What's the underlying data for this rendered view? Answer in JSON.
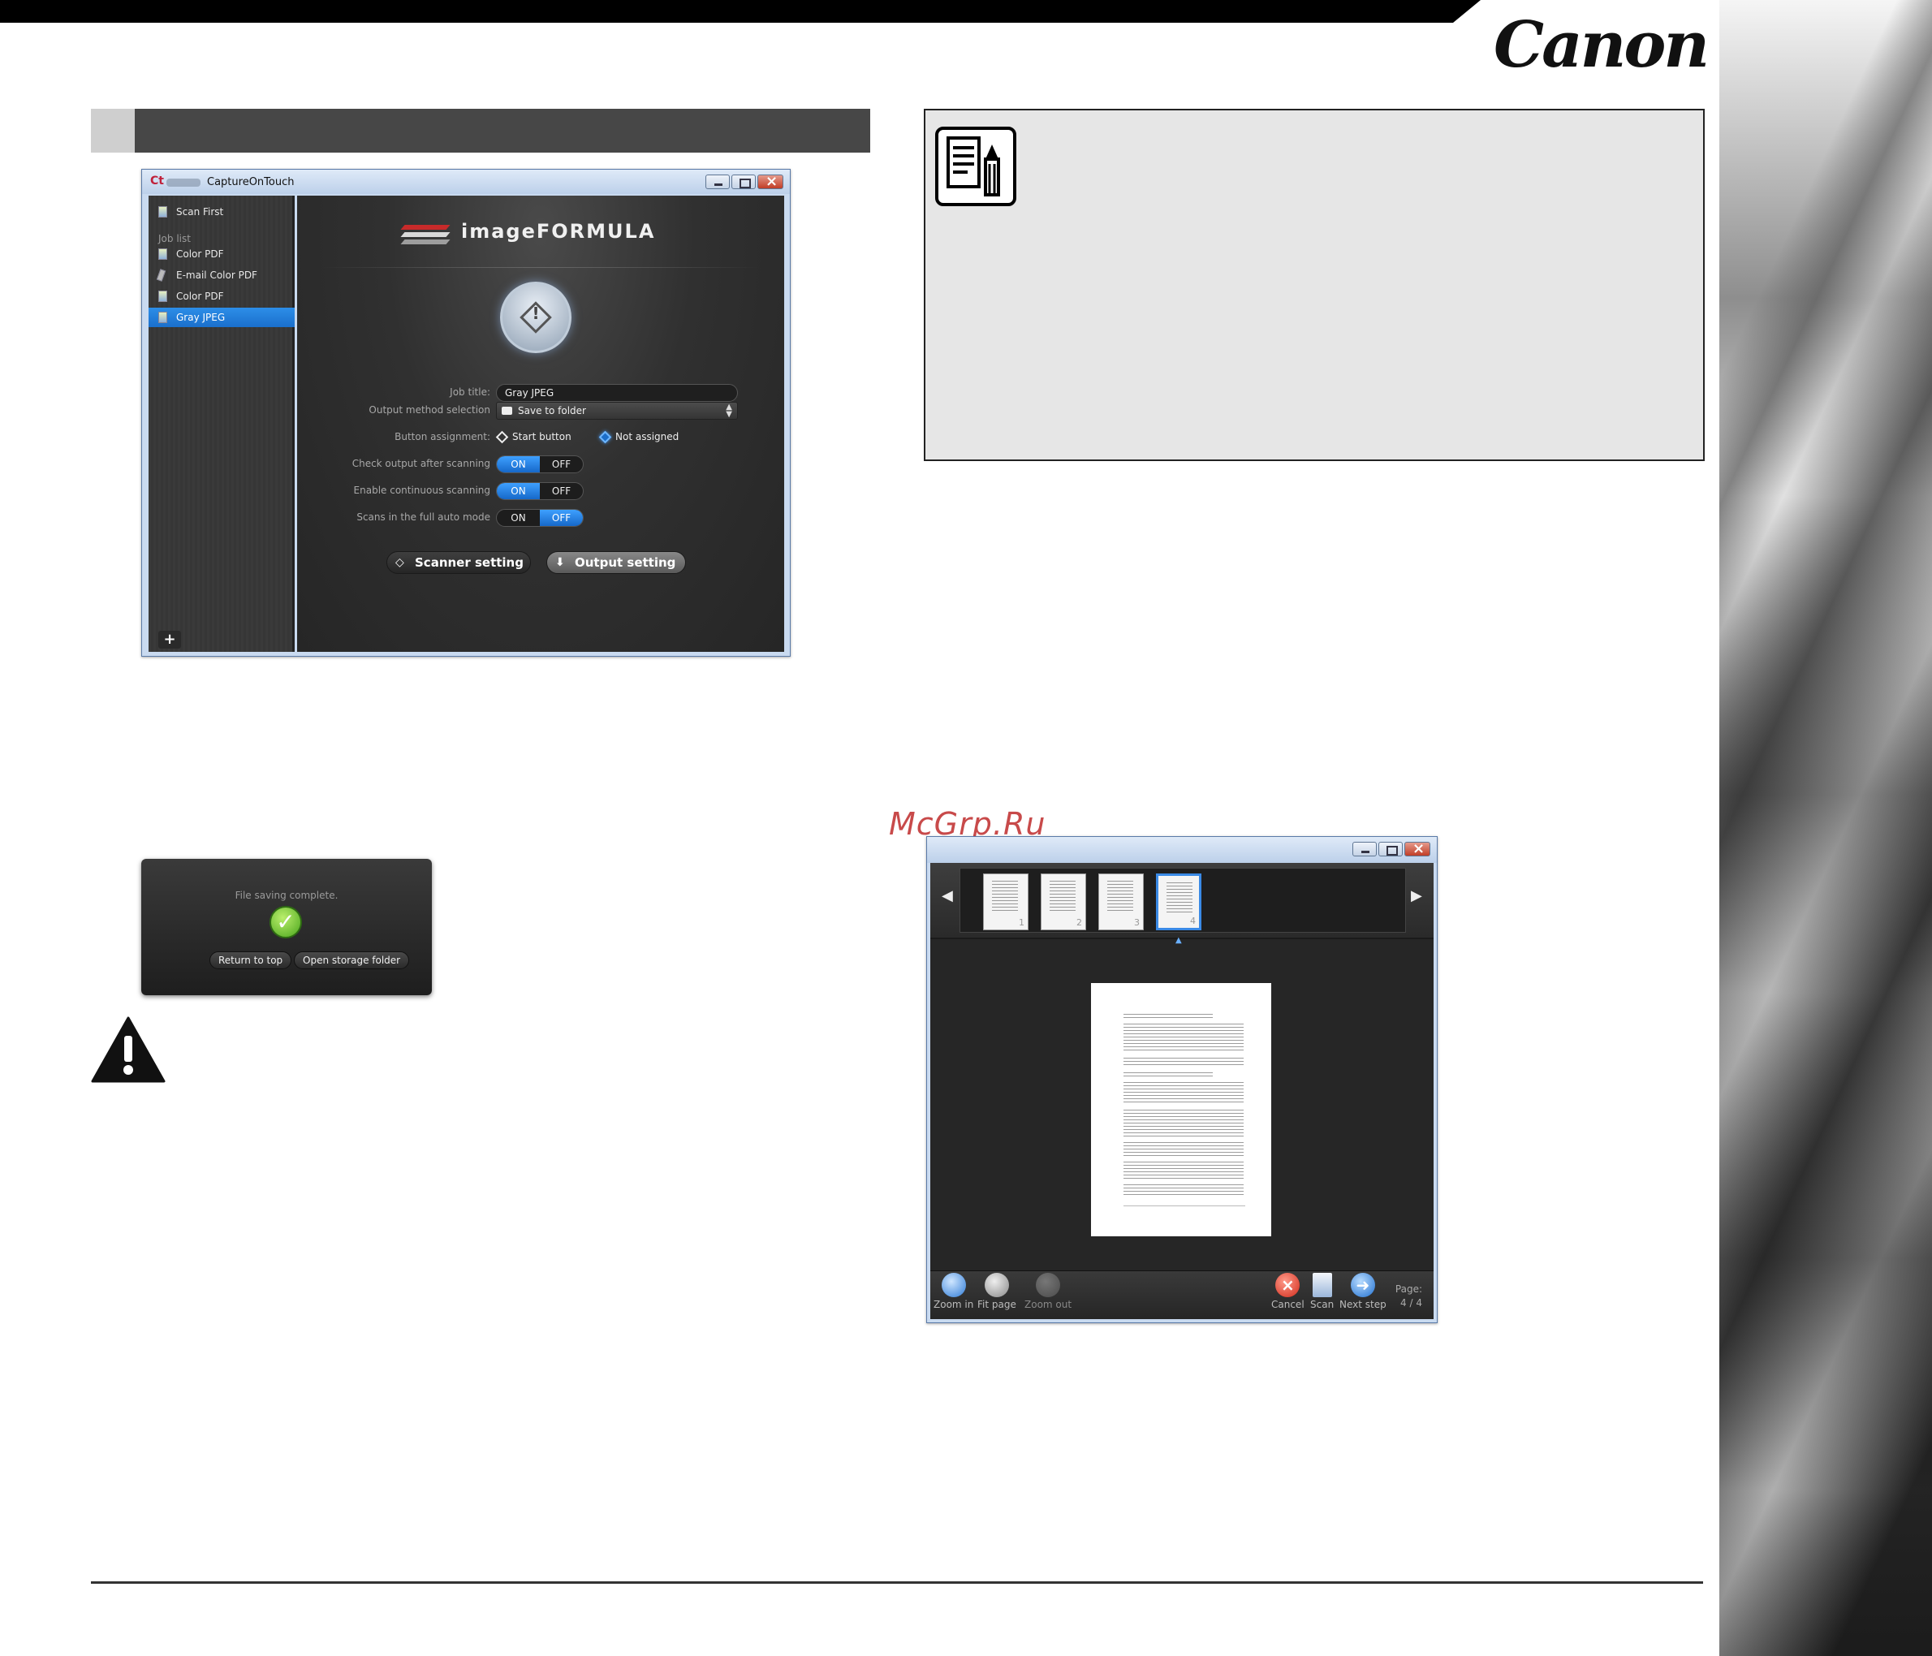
{
  "brand": {
    "logo": "Canon"
  },
  "watermark": "McGrp.Ru",
  "capture_window": {
    "title": "CaptureOnTouch",
    "app_icon": "Ct",
    "sidebar": {
      "top_item": "Scan First",
      "job_list_label": "Job list",
      "items": [
        "Color PDF",
        "E-mail Color PDF",
        "Color PDF",
        "Gray JPEG"
      ],
      "selected_index": 3,
      "add_label": "+"
    },
    "banner": "imageFORMULA",
    "start_symbol": "!",
    "form": {
      "job_title_label": "Job title:",
      "job_title_value": "Gray JPEG",
      "output_method_label": "Output method selection",
      "output_method_value": "Save to folder",
      "button_assignment_label": "Button assignment:",
      "start_button_label": "Start button",
      "not_assigned_label": "Not assigned",
      "check_output_label": "Check output after scanning",
      "continuous_label": "Enable continuous scanning",
      "full_auto_label": "Scans in the full auto mode",
      "on_label": "ON",
      "off_label": "OFF"
    },
    "toggles": {
      "check_output": "ON",
      "continuous": "ON",
      "full_auto": "OFF"
    },
    "buttons": {
      "scanner_setting": "Scanner setting",
      "output_setting": "Output setting"
    }
  },
  "save_dialog": {
    "message": "File saving complete.",
    "return_button": "Return to top",
    "open_folder_button": "Open storage folder"
  },
  "viewer_window": {
    "thumbnails": [
      "1",
      "2",
      "3",
      "4"
    ],
    "selected_thumbnail": 4,
    "toolbar": {
      "zoom_in": "Zoom in",
      "fit_page": "Fit page",
      "zoom_out": "Zoom out",
      "cancel": "Cancel",
      "scan": "Scan",
      "next_step": "Next step",
      "page_label": "Page:",
      "page_value": "4 / 4"
    }
  },
  "colors": {
    "accent_blue": "#1a6fcc",
    "dark_panel": "#2c2c2c",
    "section_bar": "#474747",
    "note_bg": "#e6e6e6",
    "watermark_red": "#c84a4a"
  },
  "icons": [
    "note-pencil-icon",
    "warning-icon",
    "checkmark-icon",
    "start-diamond-icon",
    "folder-icon"
  ]
}
